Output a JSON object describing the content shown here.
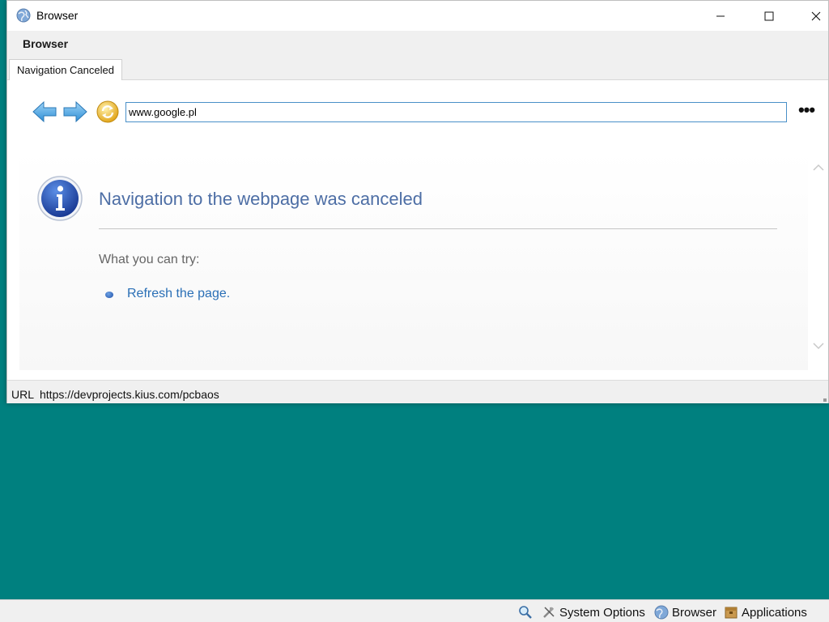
{
  "window": {
    "title": "Browser",
    "app_title": "Browser",
    "controls": {
      "minimize": "minimize-icon",
      "maximize": "maximize-icon",
      "close": "close-icon"
    }
  },
  "tabs": [
    {
      "label": "Navigation Canceled",
      "active": true
    }
  ],
  "toolbar": {
    "back_icon": "arrow-left-icon",
    "forward_icon": "arrow-right-icon",
    "refresh_icon": "refresh-icon",
    "address_value": "www.google.pl",
    "more_label": "•••"
  },
  "error_page": {
    "title": "Navigation to the webpage was canceled",
    "try_heading": "What you can try:",
    "suggestions": [
      {
        "label": "Refresh the page."
      }
    ]
  },
  "status": {
    "label": "URL",
    "value": "https://devprojects.kius.com/pcbaos"
  },
  "taskbar": {
    "items": [
      {
        "label": "",
        "icon": "search-icon"
      },
      {
        "label": "System Options",
        "icon": "tools-icon"
      },
      {
        "label": "Browser",
        "icon": "globe-icon"
      },
      {
        "label": "Applications",
        "icon": "box-icon"
      }
    ]
  },
  "colors": {
    "desktop": "#00807f",
    "title_text": "#4d6ea5",
    "link": "#2a6fb6",
    "address_border": "#4a90c8"
  }
}
